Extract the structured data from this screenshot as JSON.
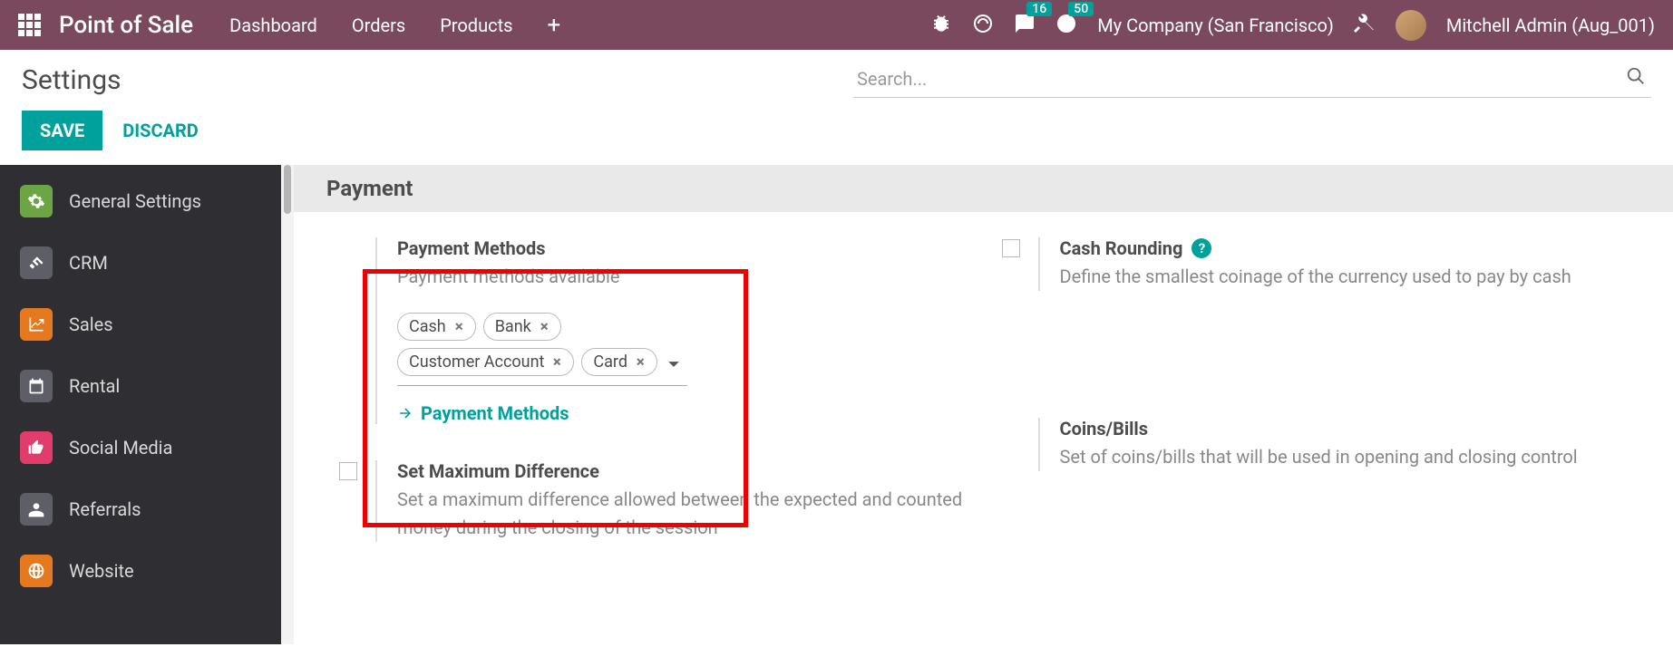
{
  "navbar": {
    "brand": "Point of Sale",
    "links": [
      "Dashboard",
      "Orders",
      "Products"
    ],
    "messages_count": "16",
    "activities_count": "50",
    "company": "My Company (San Francisco)",
    "user": "Mitchell Admin (Aug_001)"
  },
  "control_panel": {
    "title": "Settings",
    "search_placeholder": "Search...",
    "save": "SAVE",
    "discard": "DISCARD"
  },
  "sidebar": {
    "items": [
      {
        "label": "General Settings",
        "color": "#6DA544"
      },
      {
        "label": "CRM",
        "color": "#5E5E66"
      },
      {
        "label": "Sales",
        "color": "#E57920"
      },
      {
        "label": "Rental",
        "color": "#5E5E66"
      },
      {
        "label": "Social Media",
        "color": "#E03D6D"
      },
      {
        "label": "Referrals",
        "color": "#5E5E66"
      },
      {
        "label": "Website",
        "color": "#E57920"
      }
    ]
  },
  "section": {
    "title": "Payment"
  },
  "payment_methods": {
    "title": "Payment Methods",
    "desc": "Payment methods available",
    "tags": [
      "Cash",
      "Bank",
      "Customer Account",
      "Card"
    ],
    "link": "Payment Methods"
  },
  "cash_rounding": {
    "title": "Cash Rounding",
    "desc": "Define the smallest coinage of the currency used to pay by cash"
  },
  "max_diff": {
    "title": "Set Maximum Difference",
    "desc": "Set a maximum difference allowed between the expected and counted money during the closing of the session"
  },
  "coins_bills": {
    "title": "Coins/Bills",
    "desc": "Set of coins/bills that will be used in opening and closing control"
  }
}
